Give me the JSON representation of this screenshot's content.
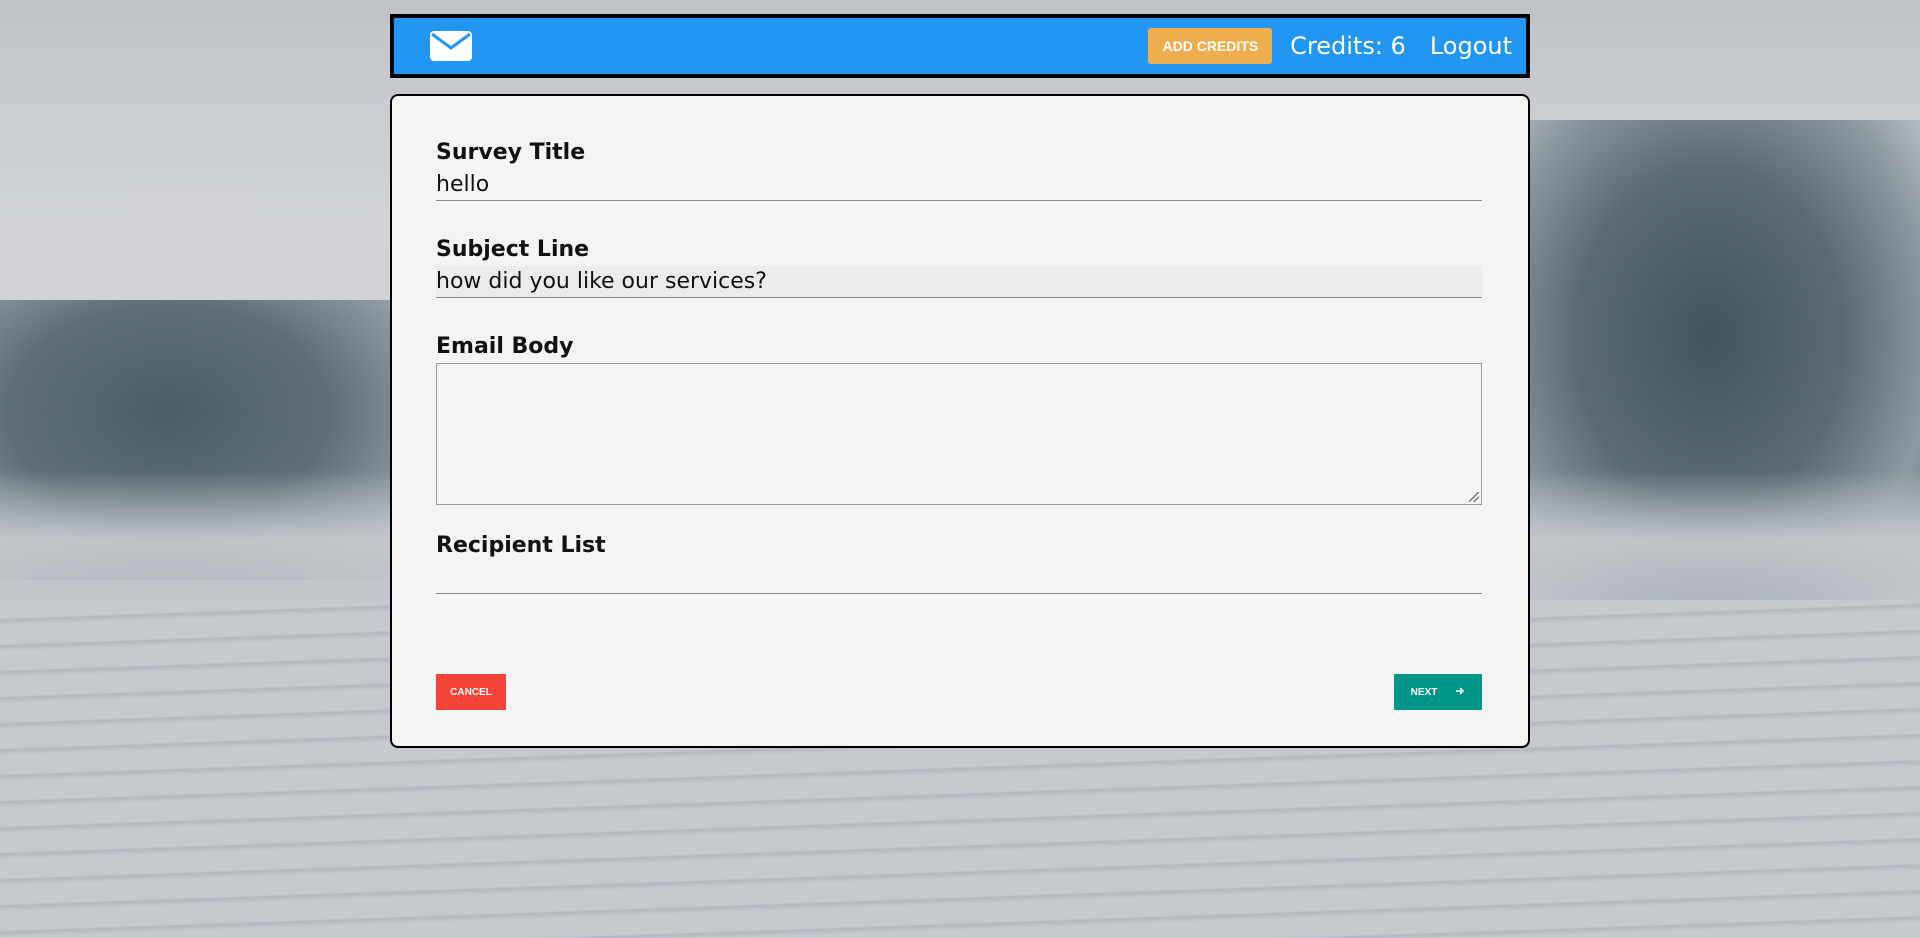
{
  "header": {
    "logo_icon": "envelope-icon",
    "add_credits_label": "Add Credits",
    "credits_text": "Credits: 6",
    "logout_label": "Logout",
    "brand_color": "#2196f3"
  },
  "form": {
    "survey_title": {
      "label": "Survey Title",
      "value": "hello"
    },
    "subject_line": {
      "label": "Subject Line",
      "value": "how did you like our services?"
    },
    "email_body": {
      "label": "Email Body",
      "value": ""
    },
    "recipient_list": {
      "label": "Recipient List",
      "value": ""
    }
  },
  "actions": {
    "cancel_label": "Cancel",
    "next_label": "Next",
    "next_icon": "arrow-right-icon",
    "cancel_color": "#f44336",
    "next_color": "#009688"
  }
}
